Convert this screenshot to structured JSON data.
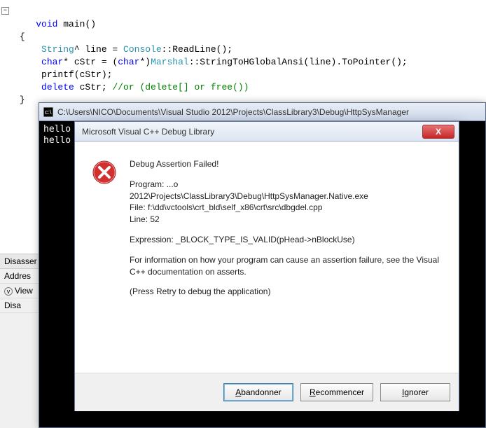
{
  "code": {
    "l1_kw": "void",
    "l1_rest": " main()",
    "l2": "{",
    "l3_typ": "String",
    "l3_a": "^ line = ",
    "l3_typ2": "Console",
    "l3_b": "::ReadLine();",
    "l4_kw": "char",
    "l4_a": "* cStr = (",
    "l4_kw2": "char",
    "l4_b": "*)",
    "l4_typ": "Marshal",
    "l4_c": "::StringToHGlobalAnsi(line).ToPointer();",
    "l5": "printf(cStr);",
    "l6_kw": "delete",
    "l6_a": " cStr; ",
    "l6_com": "//or (delete[] or free())",
    "l7": "}"
  },
  "panel": {
    "h1": "Disasser",
    "h2": "Addres",
    "row1": "View",
    "row2": "Disa"
  },
  "console": {
    "title": "C:\\Users\\NICO\\Documents\\Visual Studio 2012\\Projects\\ClassLibrary3\\Debug\\HttpSysManager",
    "line1": "hello",
    "line2": "hello"
  },
  "dialog": {
    "title": "Microsoft Visual C++ Debug Library",
    "close_x": "X",
    "heading": "Debug Assertion Failed!",
    "program_label": "Program: ...o",
    "program_path": "2012\\Projects\\ClassLibrary3\\Debug\\HttpSysManager.Native.exe",
    "file": "File: f:\\dd\\vctools\\crt_bld\\self_x86\\crt\\src\\dbgdel.cpp",
    "line": "Line: 52",
    "expression": "Expression: _BLOCK_TYPE_IS_VALID(pHead->nBlockUse)",
    "info1": "For information on how your program can cause an assertion failure, see the Visual C++ documentation on asserts.",
    "retry": "(Press Retry to debug the application)",
    "btn_abort": "Abandonner",
    "btn_retry": "Recommencer",
    "btn_ignore": "Ignorer"
  }
}
